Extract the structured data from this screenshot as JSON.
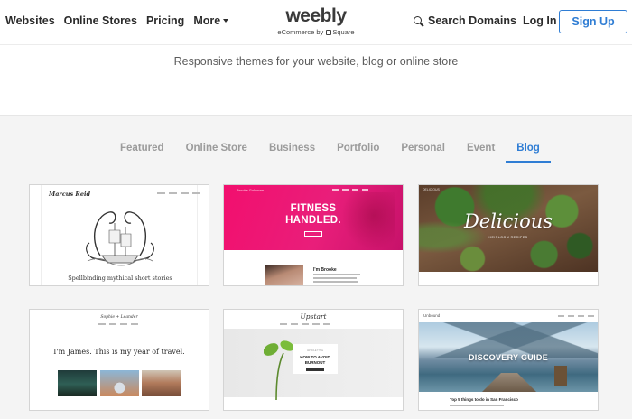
{
  "header": {
    "nav": [
      "Websites",
      "Online Stores",
      "Pricing",
      "More"
    ],
    "logo": "weebly",
    "logo_sub_left": "eCommerce by",
    "logo_sub_right": "Square",
    "search_label": "Search Domains",
    "login_label": "Log In",
    "signup_label": "Sign Up"
  },
  "tagline": "Responsive themes for your website, blog or online store",
  "tabs": [
    "Featured",
    "Online Store",
    "Business",
    "Portfolio",
    "Personal",
    "Event",
    "Blog"
  ],
  "active_tab": "Blog",
  "colors": {
    "accent": "#2f7dd4",
    "gallery_bg": "#f4f4f4",
    "fitness_pink": "#e91e7a"
  },
  "cards": [
    {
      "brand": "Marcus Reid",
      "caption": "Spellbinding mythical short stories"
    },
    {
      "brand": "Brooke Goldman",
      "headline_1": "FITNESS",
      "headline_2": "HANDLED.",
      "name": "I'm Brooke"
    },
    {
      "brand": "DELICIOUS",
      "title": "Delicious",
      "subtitle": "HEIRLOOM RECIPES"
    },
    {
      "brand": "Sophie + Leander",
      "headline": "I'm James. This is my year of travel."
    },
    {
      "brand": "Upstart",
      "kicker": "ARTICLE TITLE",
      "headline_1": "HOW TO AVOID",
      "headline_2": "BURNOUT"
    },
    {
      "brand": "Unbound",
      "title": "DISCOVERY GUIDE",
      "caption": "Top 5 things to do in San Francisco"
    }
  ]
}
